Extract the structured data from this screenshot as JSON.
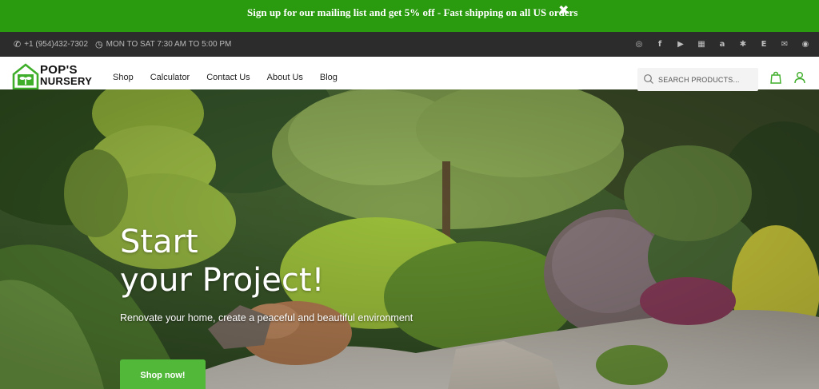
{
  "promo": {
    "message": "Sign up for our mailing list and get 5% off - Fast shipping on all US orders",
    "close_glyph": "✖"
  },
  "topbar": {
    "phone": "+1 (954)432-7302",
    "hours": "MON TO SAT 7:30 AM TO 5:00 PM",
    "socials": [
      "instagram-icon",
      "facebook-icon",
      "youtube-icon",
      "store-icon",
      "amazon-icon",
      "yelp-icon",
      "etsy-icon",
      "email-icon",
      "whatsapp-icon"
    ],
    "social_glyphs": [
      "◎",
      "f",
      "▶",
      "▦",
      "a",
      "✱",
      "E",
      "✉",
      "◉"
    ]
  },
  "logo": {
    "line1": "POP'S",
    "line2": "NURSERY",
    "brand_color": "#3fae2a"
  },
  "nav": {
    "items": [
      {
        "label": "Shop"
      },
      {
        "label": "Calculator"
      },
      {
        "label": "Contact Us"
      },
      {
        "label": "About Us"
      },
      {
        "label": "Blog"
      }
    ]
  },
  "search": {
    "placeholder": "SEARCH PRODUCTS..."
  },
  "hero": {
    "title_line1": "Start",
    "title_line2": "your Project!",
    "subtitle": "Renovate your home, create a peaceful and beautiful environment",
    "cta": "Shop now!"
  },
  "colors": {
    "promo_bg": "#2a9a0f",
    "topbar_bg": "#2c2c2c",
    "accent": "#52b83a"
  }
}
